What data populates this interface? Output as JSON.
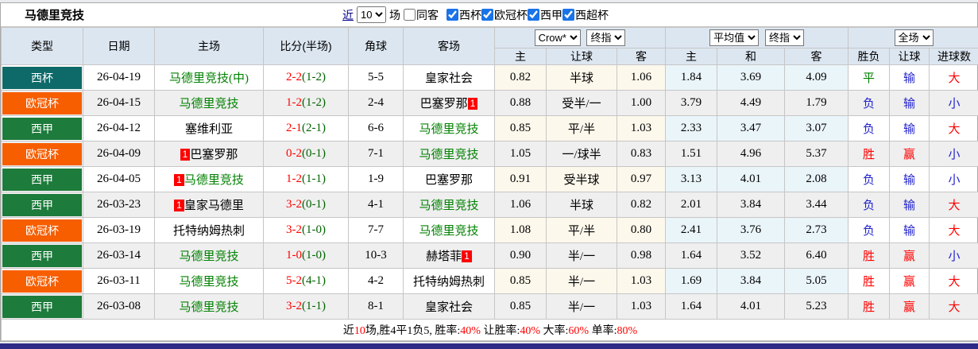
{
  "title": "马德里竞技",
  "controls": {
    "near_label": "近",
    "near_value": "10",
    "games_label": "场",
    "same_venue_label": "同客",
    "same_venue_checked": false,
    "league_filters": [
      {
        "label": "西杯",
        "checked": true
      },
      {
        "label": "欧冠杯",
        "checked": true
      },
      {
        "label": "西甲",
        "checked": true
      },
      {
        "label": "西超杯",
        "checked": true
      }
    ]
  },
  "header": {
    "static_cols": [
      "类型",
      "日期",
      "主场",
      "比分(半场)",
      "角球",
      "客场"
    ],
    "group_selects": {
      "odds_company": "Crow*",
      "odds_stage": "终指",
      "europe_company": "平均值",
      "europe_stage": "终指",
      "scope": "全场"
    },
    "sub_cols": [
      "主",
      "让球",
      "客",
      "主",
      "和",
      "客",
      "胜负",
      "让球",
      "进球数"
    ]
  },
  "colors": {
    "type_colors": {
      "西杯": "#0e6a68",
      "欧冠杯": "#f75e00",
      "西甲": "#1d7b3b"
    },
    "result_colors": {
      "胜": "#ff0000",
      "负": "#2222cc",
      "平": "#008000",
      "赢": "#ff0000",
      "输": "#2222cc",
      "大": "#ff0000",
      "小": "#2222cc"
    },
    "accent_red": "#ff0000",
    "header_bg": "#dce6f1",
    "bottom_bar": "#2d2b86"
  },
  "badge_text": "1",
  "rows": [
    {
      "type": "西杯",
      "date": "26-04-19",
      "home": "马德里竞技(中)",
      "home_green": true,
      "home_badge": null,
      "away": "皇家社会",
      "away_green": false,
      "away_badge": null,
      "score": "2-2",
      "half": "(1-2)",
      "corner": "5-5",
      "asia": [
        "0.82",
        "半球",
        "1.06"
      ],
      "euro": [
        "1.84",
        "3.69",
        "4.09"
      ],
      "results": [
        "平",
        "输",
        "大"
      ]
    },
    {
      "type": "欧冠杯",
      "date": "26-04-15",
      "home": "马德里竞技",
      "home_green": true,
      "home_badge": null,
      "away": "巴塞罗那",
      "away_green": false,
      "away_badge": "after",
      "score": "1-2",
      "half": "(1-2)",
      "corner": "2-4",
      "asia": [
        "0.88",
        "受半/一",
        "1.00"
      ],
      "euro": [
        "3.79",
        "4.49",
        "1.79"
      ],
      "results": [
        "负",
        "输",
        "小"
      ]
    },
    {
      "type": "西甲",
      "date": "26-04-12",
      "home": "塞维利亚",
      "home_green": false,
      "home_badge": null,
      "away": "马德里竞技",
      "away_green": true,
      "away_badge": null,
      "score": "2-1",
      "half": "(2-1)",
      "corner": "6-6",
      "asia": [
        "0.85",
        "平/半",
        "1.03"
      ],
      "euro": [
        "2.33",
        "3.47",
        "3.07"
      ],
      "results": [
        "负",
        "输",
        "大"
      ]
    },
    {
      "type": "欧冠杯",
      "date": "26-04-09",
      "home": "巴塞罗那",
      "home_green": false,
      "home_badge": "before",
      "away": "马德里竞技",
      "away_green": true,
      "away_badge": null,
      "score": "0-2",
      "half": "(0-1)",
      "corner": "7-1",
      "asia": [
        "1.05",
        "一/球半",
        "0.83"
      ],
      "euro": [
        "1.51",
        "4.96",
        "5.37"
      ],
      "results": [
        "胜",
        "赢",
        "小"
      ]
    },
    {
      "type": "西甲",
      "date": "26-04-05",
      "home": "马德里竞技",
      "home_green": true,
      "home_badge": "before",
      "away": "巴塞罗那",
      "away_green": false,
      "away_badge": null,
      "score": "1-2",
      "half": "(1-1)",
      "corner": "1-9",
      "asia": [
        "0.91",
        "受半球",
        "0.97"
      ],
      "euro": [
        "3.13",
        "4.01",
        "2.08"
      ],
      "results": [
        "负",
        "输",
        "小"
      ]
    },
    {
      "type": "西甲",
      "date": "26-03-23",
      "home": "皇家马德里",
      "home_green": false,
      "home_badge": "before",
      "away": "马德里竞技",
      "away_green": true,
      "away_badge": null,
      "score": "3-2",
      "half": "(0-1)",
      "corner": "4-1",
      "asia": [
        "1.06",
        "半球",
        "0.82"
      ],
      "euro": [
        "2.01",
        "3.84",
        "3.44"
      ],
      "results": [
        "负",
        "输",
        "大"
      ]
    },
    {
      "type": "欧冠杯",
      "date": "26-03-19",
      "home": "托特纳姆热刺",
      "home_green": false,
      "home_badge": null,
      "away": "马德里竞技",
      "away_green": true,
      "away_badge": null,
      "score": "3-2",
      "half": "(1-0)",
      "corner": "7-7",
      "asia": [
        "1.08",
        "平/半",
        "0.80"
      ],
      "euro": [
        "2.41",
        "3.76",
        "2.73"
      ],
      "results": [
        "负",
        "输",
        "大"
      ]
    },
    {
      "type": "西甲",
      "date": "26-03-14",
      "home": "马德里竞技",
      "home_green": true,
      "home_badge": null,
      "away": "赫塔菲",
      "away_green": false,
      "away_badge": "after",
      "score": "1-0",
      "half": "(1-0)",
      "corner": "10-3",
      "asia": [
        "0.90",
        "半/一",
        "0.98"
      ],
      "euro": [
        "1.64",
        "3.52",
        "6.40"
      ],
      "results": [
        "胜",
        "赢",
        "小"
      ]
    },
    {
      "type": "欧冠杯",
      "date": "26-03-11",
      "home": "马德里竞技",
      "home_green": true,
      "home_badge": null,
      "away": "托特纳姆热刺",
      "away_green": false,
      "away_badge": null,
      "score": "5-2",
      "half": "(4-1)",
      "corner": "4-2",
      "asia": [
        "0.85",
        "半/一",
        "1.03"
      ],
      "euro": [
        "1.69",
        "3.84",
        "5.05"
      ],
      "results": [
        "胜",
        "赢",
        "大"
      ]
    },
    {
      "type": "西甲",
      "date": "26-03-08",
      "home": "马德里竞技",
      "home_green": true,
      "home_badge": null,
      "away": "皇家社会",
      "away_green": false,
      "away_badge": null,
      "score": "3-2",
      "half": "(1-1)",
      "corner": "8-1",
      "asia": [
        "0.85",
        "半/一",
        "1.03"
      ],
      "euro": [
        "1.64",
        "4.01",
        "5.23"
      ],
      "results": [
        "胜",
        "赢",
        "大"
      ]
    }
  ],
  "summary_segments": [
    {
      "text": "近",
      "red": false
    },
    {
      "text": "10",
      "red": true
    },
    {
      "text": "场,胜4平1负5, 胜率:",
      "red": false
    },
    {
      "text": "40%",
      "red": true
    },
    {
      "text": " 让胜率:",
      "red": false
    },
    {
      "text": "40%",
      "red": true
    },
    {
      "text": " 大率:",
      "red": false
    },
    {
      "text": "60%",
      "red": true
    },
    {
      "text": " 单率:",
      "red": false
    },
    {
      "text": "80%",
      "red": true
    }
  ]
}
